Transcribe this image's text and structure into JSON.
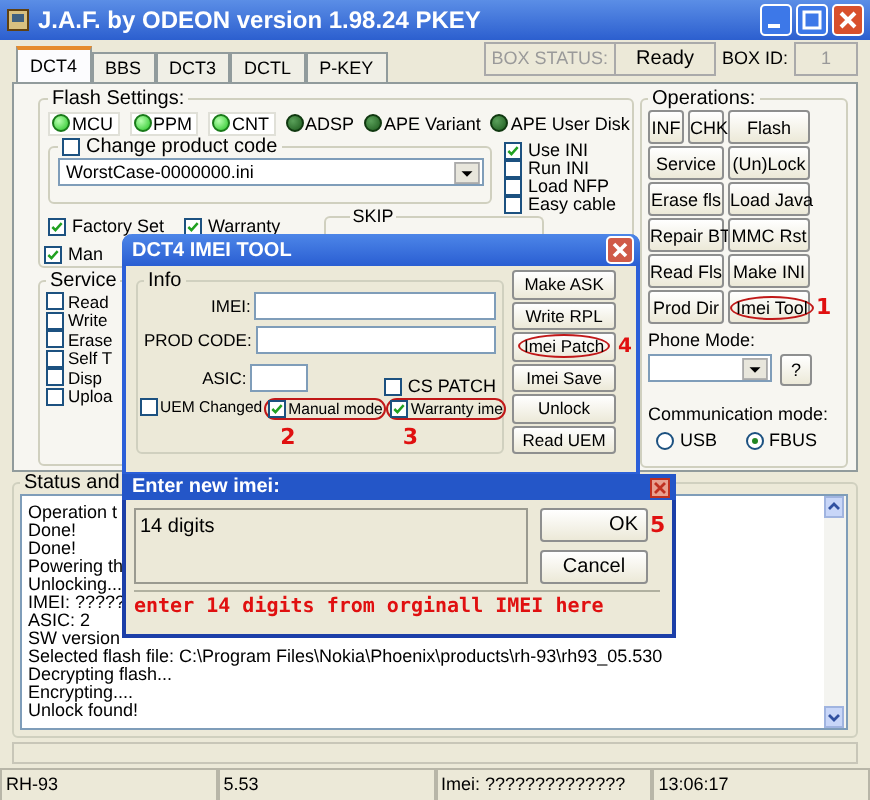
{
  "window": {
    "title": "J.A.F. by ODEON version 1.98.24 PKEY"
  },
  "tabs": [
    {
      "label": "DCT4",
      "selected": true
    },
    {
      "label": "BBS",
      "selected": false
    },
    {
      "label": "DCT3",
      "selected": false
    },
    {
      "label": "DCTL",
      "selected": false
    },
    {
      "label": "P-KEY",
      "selected": false
    }
  ],
  "box": {
    "status_label": "BOX STATUS:",
    "status": "Ready",
    "id_label": "BOX ID:",
    "id": "1"
  },
  "flash_settings": {
    "title": "Flash Settings:",
    "leds": [
      {
        "label": "MCU",
        "on": true
      },
      {
        "label": "PPM",
        "on": true
      },
      {
        "label": "CNT",
        "on": true
      },
      {
        "label": "ADSP",
        "on": false
      },
      {
        "label": "APE Variant",
        "on": false
      },
      {
        "label": "APE User Disk",
        "on": false
      }
    ],
    "product_code": {
      "label": "Change product code",
      "checked": false,
      "file": "WorstCase-0000000.ini"
    },
    "ini_options": [
      {
        "label": "Use INI",
        "checked": true
      },
      {
        "label": "Run INI",
        "checked": false
      },
      {
        "label": "Load NFP",
        "checked": false
      },
      {
        "label": "Easy cable",
        "checked": false
      }
    ],
    "options": [
      {
        "label": "Factory Set",
        "checked": true
      },
      {
        "label": "Warranty",
        "checked": true
      },
      {
        "label": "Man",
        "checked": true
      }
    ],
    "skip_title": "SKIP"
  },
  "service": {
    "title": "Service",
    "options": [
      {
        "label": "Read",
        "checked": false
      },
      {
        "label": "Write",
        "checked": false
      },
      {
        "label": "Erase",
        "checked": false
      },
      {
        "label": "Self T",
        "checked": false
      },
      {
        "label": "Disp",
        "checked": false
      },
      {
        "label": "Uploa",
        "checked": false
      }
    ]
  },
  "operations": {
    "title": "Operations:",
    "buttons": [
      {
        "label": "INF",
        "kind": "small",
        "circled": false
      },
      {
        "label": "CHK",
        "kind": "small",
        "circled": false
      },
      {
        "label": "Flash",
        "kind": "wide",
        "circled": false
      },
      {
        "label": "Service",
        "kind": "wide",
        "circled": false
      },
      {
        "label": "(Un)Lock",
        "kind": "wide",
        "circled": false
      },
      {
        "label": "Erase fls",
        "kind": "wide",
        "circled": false
      },
      {
        "label": "Load Java",
        "kind": "wide",
        "circled": false
      },
      {
        "label": "Repair BT",
        "kind": "wide",
        "circled": false
      },
      {
        "label": "MMC Rst",
        "kind": "wide",
        "circled": false
      },
      {
        "label": "Read Fls",
        "kind": "wide",
        "circled": false
      },
      {
        "label": "Make INI",
        "kind": "wide",
        "circled": false
      },
      {
        "label": "Prod Dir",
        "kind": "wide",
        "circled": false
      },
      {
        "label": "Imei Tool",
        "kind": "wide",
        "circled": true,
        "note": "1"
      }
    ]
  },
  "phone_mode": {
    "label": "Phone Mode:",
    "help": "?"
  },
  "communication": {
    "label": "Communication mode:",
    "options": [
      {
        "label": "USB",
        "selected": false
      },
      {
        "label": "FBUS",
        "selected": true
      }
    ]
  },
  "status": {
    "title": "Status and",
    "log": [
      "Operation t",
      "Done!",
      "Done!",
      "Powering th",
      "Unlocking...",
      "IMEI: ?????",
      "ASIC: 2",
      "SW version",
      "Selected flash file: C:\\Program Files\\Nokia\\Phoenix\\products\\rh-93\\rh93_05.530",
      "Decrypting flash...",
      "Encrypting....",
      "Unlock found!"
    ]
  },
  "progress": {
    "level": 0
  },
  "status_bar": [
    "RH-93",
    "5.53",
    "Imei: ??????????????",
    "13:06:17"
  ],
  "imei_tool": {
    "title": "DCT4 IMEI TOOL",
    "info_title": "Info",
    "fields": [
      {
        "label": "IMEI:",
        "kind": "long"
      },
      {
        "label": "PROD CODE:",
        "kind": "long"
      },
      {
        "label": "ASIC:",
        "kind": "short"
      }
    ],
    "cs_patch": {
      "label": "CS PATCH",
      "checked": false
    },
    "options": [
      {
        "label": "UEM Changed",
        "checked": false,
        "circled": false
      },
      {
        "label": "Manual mode",
        "checked": true,
        "circled": true,
        "note": "2"
      },
      {
        "label": "Warranty ime",
        "checked": true,
        "circled": true,
        "note": "3"
      }
    ],
    "buttons": [
      {
        "label": "Make ASK",
        "circled": false
      },
      {
        "label": "Write RPL",
        "circled": false
      },
      {
        "label": "Imei Patch",
        "circled": true,
        "note": "4"
      },
      {
        "label": "Imei Save",
        "circled": false
      },
      {
        "label": "Unlock",
        "circled": false
      },
      {
        "label": "Read UEM",
        "circled": false
      }
    ]
  },
  "imei_dialog": {
    "title": "Enter new imei:",
    "value": "14 digits",
    "ok": "OK",
    "ok_note": "5",
    "cancel": "Cancel",
    "hint": "enter 14 digits from orginall IMEI here"
  }
}
